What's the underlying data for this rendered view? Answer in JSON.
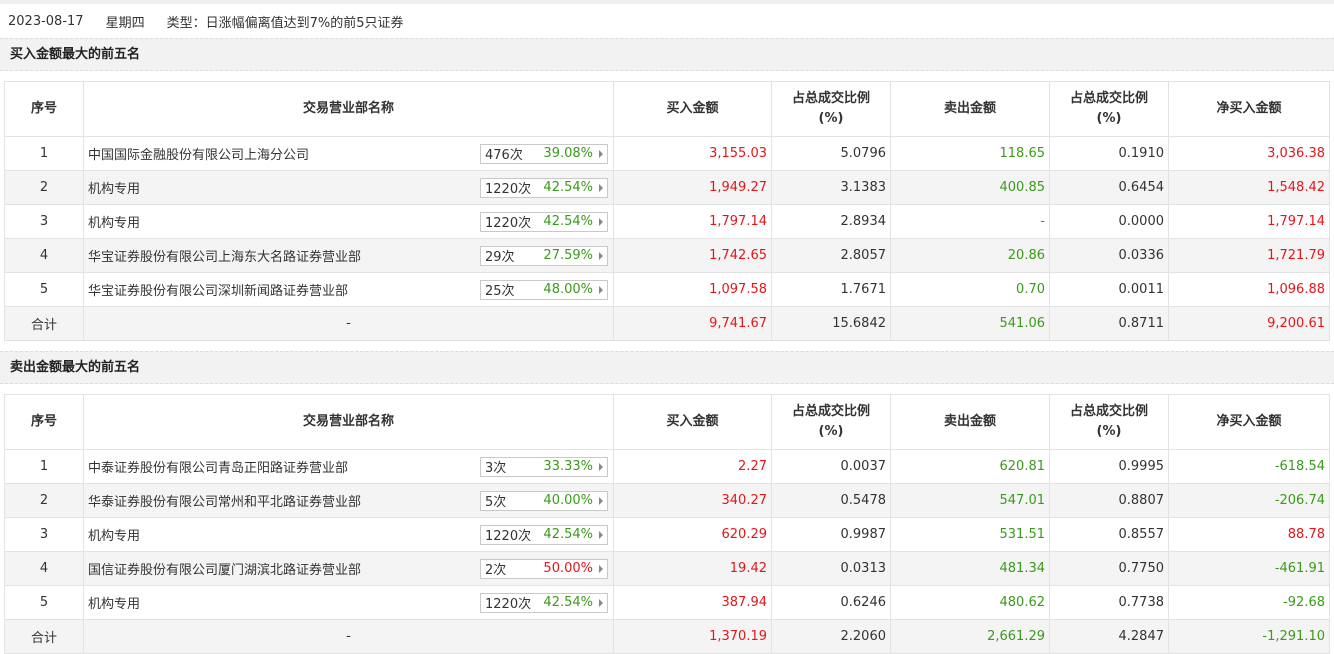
{
  "header": {
    "date": "2023-08-17",
    "weekday": "星期四",
    "type": "类型：日涨幅偏离值达到7%的前5只证券"
  },
  "columns": [
    "序号",
    "交易营业部名称",
    "买入金额",
    "占总成交比例\n(%)",
    "卖出金额",
    "占总成交比例\n(%)",
    "净买入金额"
  ],
  "colors": {
    "red": "#e4161a",
    "green": "#3a9b1a"
  },
  "buy_table": {
    "title": "买入金额最大的前五名",
    "rows": [
      {
        "idx": "1",
        "name": "中国国际金融股份有限公司上海分公司",
        "count": "476次",
        "pct": "39.08%",
        "pct_color": "green",
        "buy": "3,155.03",
        "buy_ratio": "5.0796",
        "sell": "118.65",
        "sell_ratio": "0.1910",
        "net": "3,036.38",
        "net_color": "red"
      },
      {
        "idx": "2",
        "name": "机构专用",
        "count": "1220次",
        "pct": "42.54%",
        "pct_color": "green",
        "buy": "1,949.27",
        "buy_ratio": "3.1383",
        "sell": "400.85",
        "sell_ratio": "0.6454",
        "net": "1,548.42",
        "net_color": "red"
      },
      {
        "idx": "3",
        "name": "机构专用",
        "count": "1220次",
        "pct": "42.54%",
        "pct_color": "green",
        "buy": "1,797.14",
        "buy_ratio": "2.8934",
        "sell": "-",
        "sell_ratio": "0.0000",
        "net": "1,797.14",
        "net_color": "red"
      },
      {
        "idx": "4",
        "name": "华宝证券股份有限公司上海东大名路证券营业部",
        "count": "29次",
        "pct": "27.59%",
        "pct_color": "green",
        "buy": "1,742.65",
        "buy_ratio": "2.8057",
        "sell": "20.86",
        "sell_ratio": "0.0336",
        "net": "1,721.79",
        "net_color": "red"
      },
      {
        "idx": "5",
        "name": "华宝证券股份有限公司深圳新闻路证券营业部",
        "count": "25次",
        "pct": "48.00%",
        "pct_color": "green",
        "buy": "1,097.58",
        "buy_ratio": "1.7671",
        "sell": "0.70",
        "sell_ratio": "0.0011",
        "net": "1,096.88",
        "net_color": "red"
      }
    ],
    "total": {
      "label": "合计",
      "name": "-",
      "buy": "9,741.67",
      "buy_ratio": "15.6842",
      "sell": "541.06",
      "sell_ratio": "0.8711",
      "net": "9,200.61",
      "net_color": "red"
    }
  },
  "sell_table": {
    "title": "卖出金额最大的前五名",
    "rows": [
      {
        "idx": "1",
        "name": "中泰证券股份有限公司青岛正阳路证券营业部",
        "count": "3次",
        "pct": "33.33%",
        "pct_color": "green",
        "buy": "2.27",
        "buy_ratio": "0.0037",
        "sell": "620.81",
        "sell_ratio": "0.9995",
        "net": "-618.54",
        "net_color": "green"
      },
      {
        "idx": "2",
        "name": "华泰证券股份有限公司常州和平北路证券营业部",
        "count": "5次",
        "pct": "40.00%",
        "pct_color": "green",
        "buy": "340.27",
        "buy_ratio": "0.5478",
        "sell": "547.01",
        "sell_ratio": "0.8807",
        "net": "-206.74",
        "net_color": "green"
      },
      {
        "idx": "3",
        "name": "机构专用",
        "count": "1220次",
        "pct": "42.54%",
        "pct_color": "green",
        "buy": "620.29",
        "buy_ratio": "0.9987",
        "sell": "531.51",
        "sell_ratio": "0.8557",
        "net": "88.78",
        "net_color": "red"
      },
      {
        "idx": "4",
        "name": "国信证券股份有限公司厦门湖滨北路证券营业部",
        "count": "2次",
        "pct": "50.00%",
        "pct_color": "red",
        "buy": "19.42",
        "buy_ratio": "0.0313",
        "sell": "481.34",
        "sell_ratio": "0.7750",
        "net": "-461.91",
        "net_color": "green"
      },
      {
        "idx": "5",
        "name": "机构专用",
        "count": "1220次",
        "pct": "42.54%",
        "pct_color": "green",
        "buy": "387.94",
        "buy_ratio": "0.6246",
        "sell": "480.62",
        "sell_ratio": "0.7738",
        "net": "-92.68",
        "net_color": "green"
      }
    ],
    "total": {
      "label": "合计",
      "name": "-",
      "buy": "1,370.19",
      "buy_ratio": "2.2060",
      "sell": "2,661.29",
      "sell_ratio": "4.2847",
      "net": "-1,291.10",
      "net_color": "green"
    }
  }
}
